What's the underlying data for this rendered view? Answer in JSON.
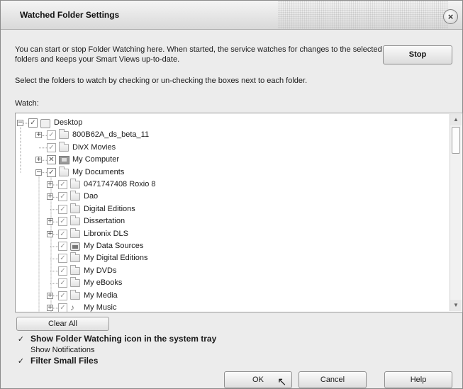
{
  "window": {
    "title": "Watched Folder Settings",
    "close_glyph": "×"
  },
  "description": "You can start or stop Folder Watching here. When started, the service watches for changes to the selected folders and keeps your Smart Views up-to-date.",
  "stop_button": "Stop",
  "instruction": "Select the folders to watch by checking or un-checking the boxes next to each folder.",
  "watch_label": "Watch:",
  "tree": {
    "items": [
      {
        "label": "Desktop",
        "icon": "desktop-icon",
        "check": "checked",
        "expander": "−"
      },
      {
        "label": "800B62A_ds_beta_11",
        "icon": "folder-icon",
        "check": "checked-grey",
        "expander": "+"
      },
      {
        "label": "DivX Movies",
        "icon": "folder-icon",
        "check": "checked-grey",
        "expander": ""
      },
      {
        "label": "My Computer",
        "icon": "computer-icon",
        "check": "crossed",
        "expander": "+"
      },
      {
        "label": "My Documents",
        "icon": "folder-icon",
        "check": "checked",
        "expander": "−"
      },
      {
        "label": "0471747408 Roxio 8",
        "icon": "folder-icon",
        "check": "checked-grey",
        "expander": "+"
      },
      {
        "label": "Dao",
        "icon": "folder-icon",
        "check": "checked-grey",
        "expander": "+"
      },
      {
        "label": "Digital Editions",
        "icon": "folder-icon",
        "check": "checked-grey",
        "expander": ""
      },
      {
        "label": "Dissertation",
        "icon": "folder-icon",
        "check": "checked-grey",
        "expander": "+"
      },
      {
        "label": "Libronix DLS",
        "icon": "folder-icon",
        "check": "checked-grey",
        "expander": "+"
      },
      {
        "label": "My Data Sources",
        "icon": "data-sources-icon",
        "check": "checked-grey",
        "expander": ""
      },
      {
        "label": "My Digital Editions",
        "icon": "folder-icon",
        "check": "checked-grey",
        "expander": ""
      },
      {
        "label": "My DVDs",
        "icon": "folder-icon",
        "check": "checked-grey",
        "expander": ""
      },
      {
        "label": "My eBooks",
        "icon": "folder-icon",
        "check": "checked-grey",
        "expander": ""
      },
      {
        "label": "My Media",
        "icon": "folder-icon",
        "check": "checked-grey",
        "expander": "+"
      },
      {
        "label": "My Music",
        "icon": "music-folder-icon",
        "check": "checked-grey",
        "expander": "+"
      }
    ]
  },
  "clear_all_button": "Clear All",
  "options": [
    {
      "label": "Show Folder Watching icon in the system tray",
      "checked": true,
      "bold": true
    },
    {
      "label": "Show Notifications",
      "checked": false,
      "bold": false
    },
    {
      "label": "Filter Small Files",
      "checked": true,
      "bold": true
    }
  ],
  "buttons": {
    "ok": "OK",
    "cancel": "Cancel",
    "help": "Help"
  },
  "scrollbar": {
    "up_glyph": "▲",
    "down_glyph": "▼"
  },
  "check_glyph": "✓",
  "cross_glyph": "✕"
}
